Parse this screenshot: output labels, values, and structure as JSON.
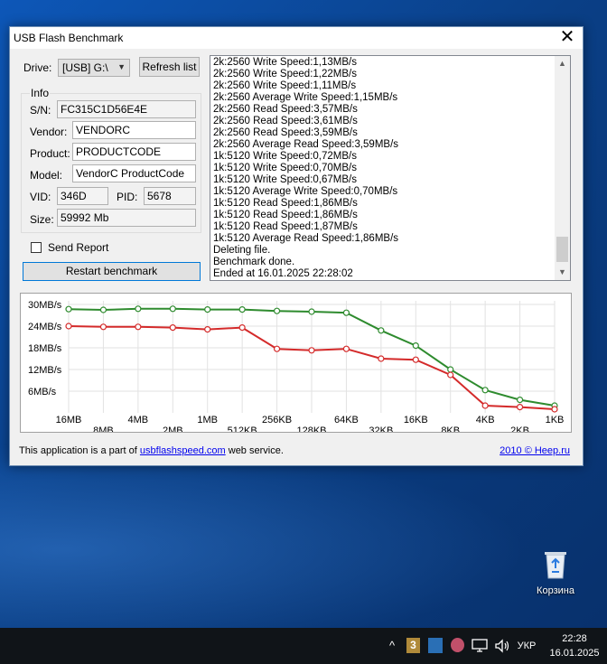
{
  "window": {
    "title": "USB Flash Benchmark",
    "close_glyph": "✕"
  },
  "drive": {
    "label": "Drive:",
    "selected": "[USB] G:\\",
    "refresh_label": "Refresh list"
  },
  "info": {
    "group_label": "Info",
    "sn_label": "S/N:",
    "sn": "FC315C1D56E4E",
    "vendor_label": "Vendor:",
    "vendor": "VENDORC",
    "product_label": "Product:",
    "product": "PRODUCTCODE",
    "model_label": "Model:",
    "model": "VendorC ProductCode",
    "vid_label": "VID:",
    "vid": "346D",
    "pid_label": "PID:",
    "pid": "5678",
    "size_label": "Size:",
    "size": "59992 Mb"
  },
  "send_report_label": "Send Report",
  "restart_label": "Restart benchmark",
  "log_lines": [
    "2k:2560 Write Speed:1,13MB/s",
    "2k:2560 Write Speed:1,22MB/s",
    "2k:2560 Write Speed:1,11MB/s",
    "2k:2560 Average Write Speed:1,15MB/s",
    "2k:2560 Read Speed:3,57MB/s",
    "2k:2560 Read Speed:3,61MB/s",
    "2k:2560 Read Speed:3,59MB/s",
    "2k:2560 Average Read Speed:3,59MB/s",
    "1k:5120 Write Speed:0,72MB/s",
    "1k:5120 Write Speed:0,70MB/s",
    "1k:5120 Write Speed:0,67MB/s",
    "1k:5120 Average Write Speed:0,70MB/s",
    "1k:5120 Read Speed:1,86MB/s",
    "1k:5120 Read Speed:1,86MB/s",
    "1k:5120 Read Speed:1,87MB/s",
    "1k:5120 Average Read Speed:1,86MB/s",
    "Deleting file.",
    "Benchmark done.",
    "Ended at 16.01.2025 22:28:02"
  ],
  "chart_data": {
    "type": "line",
    "ylim": [
      0,
      31
    ],
    "y_ticks": [
      {
        "label": "30MB/s",
        "value": 30
      },
      {
        "label": "24MB/s",
        "value": 24
      },
      {
        "label": "18MB/s",
        "value": 18
      },
      {
        "label": "12MB/s",
        "value": 12
      },
      {
        "label": "6MB/s",
        "value": 6
      }
    ],
    "categories": [
      "16MB",
      "8MB",
      "4MB",
      "2MB",
      "1MB",
      "512KB",
      "256KB",
      "128KB",
      "64KB",
      "32KB",
      "16KB",
      "8KB",
      "4KB",
      "2KB",
      "1KB"
    ],
    "series": [
      {
        "color": "#2e8b2e",
        "values": [
          28.7,
          28.5,
          28.8,
          28.8,
          28.6,
          28.6,
          28.2,
          28.0,
          27.7,
          22.8,
          18.6,
          12.0,
          6.3,
          3.6,
          2.0
        ]
      },
      {
        "color": "#d42a2a",
        "values": [
          24.0,
          23.8,
          23.8,
          23.6,
          23.1,
          23.6,
          17.7,
          17.3,
          17.7,
          15.0,
          14.7,
          10.5,
          2.0,
          1.6,
          1.0
        ]
      }
    ]
  },
  "footer": {
    "prefix": "This application is a part of ",
    "link": "usbflashspeed.com",
    "suffix": " web service.",
    "copyright": "2010 © Heep.ru"
  },
  "desktop": {
    "recycle_label": "Корзина"
  },
  "taskbar": {
    "chevron": "^",
    "lang": "УКР",
    "time": "22:28",
    "date": "16.01.2025"
  }
}
